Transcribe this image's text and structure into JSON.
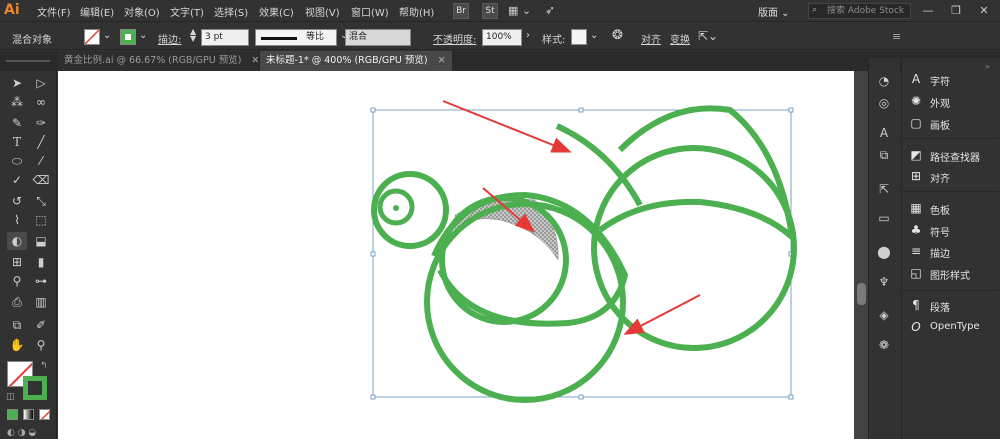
{
  "app": {
    "logo": "Ai",
    "menus": [
      "文件(F)",
      "编辑(E)",
      "对象(O)",
      "文字(T)",
      "选择(S)",
      "效果(C)",
      "视图(V)",
      "窗口(W)",
      "帮助(H)"
    ],
    "bridge_btn": "Br",
    "stock_btn": "St",
    "workspace": "版面",
    "search_placeholder": "搜索 Adobe Stock",
    "win_min": "—",
    "win_max": "❐",
    "win_close": "✕"
  },
  "control": {
    "selection_label": "混合对象",
    "stroke_label": "描边:",
    "stroke_value": "3 pt",
    "profile_label": "等比",
    "blend_mode": "混合",
    "opacity_label": "不透明度:",
    "opacity_value": "100%",
    "style_label": "样式:",
    "align_link": "对齐",
    "transform_link": "变换"
  },
  "tabs": [
    {
      "label": "黄金比例.ai @ 66.67% (RGB/GPU 预览)",
      "close": "✕"
    },
    {
      "label": "未标题-1* @ 400% (RGB/GPU 预览)",
      "close": "✕"
    }
  ],
  "panels": [
    {
      "icon": "A",
      "label": "字符"
    },
    {
      "icon": "✺",
      "label": "外观"
    },
    {
      "icon": "▢",
      "label": "画板"
    },
    {
      "icon": "◩",
      "label": "路径查找器"
    },
    {
      "icon": "⊞",
      "label": "对齐"
    },
    {
      "icon": "▦",
      "label": "色板"
    },
    {
      "icon": "♣",
      "label": "符号"
    },
    {
      "icon": "≡",
      "label": "描边"
    },
    {
      "icon": "◱",
      "label": "图形样式"
    },
    {
      "icon": "¶",
      "label": "段落"
    },
    {
      "icon": "O",
      "label": "OpenType"
    }
  ],
  "colors": {
    "stroke_green": "#4caf50",
    "arrow_red": "#e53935",
    "fill_swatch": "#4caf50",
    "bbox_blue": "#5b8db8"
  },
  "icons": {
    "tools": [
      "selection-icon",
      "direct-selection-icon",
      "magic-wand-icon",
      "lasso-icon",
      "pen-icon",
      "curvature-icon",
      "type-icon",
      "line-icon",
      "ellipse-icon",
      "paintbrush-icon",
      "shaper-icon",
      "eraser-icon",
      "rotate-icon",
      "scale-icon",
      "width-icon",
      "free-transform-icon",
      "shape-builder-icon",
      "perspective-icon",
      "mesh-icon",
      "gradient-icon",
      "eyedropper-icon",
      "blend-icon",
      "symbol-sprayer-icon",
      "graph-icon",
      "artboard-icon",
      "slice-icon",
      "hand-icon",
      "zoom-icon"
    ]
  }
}
